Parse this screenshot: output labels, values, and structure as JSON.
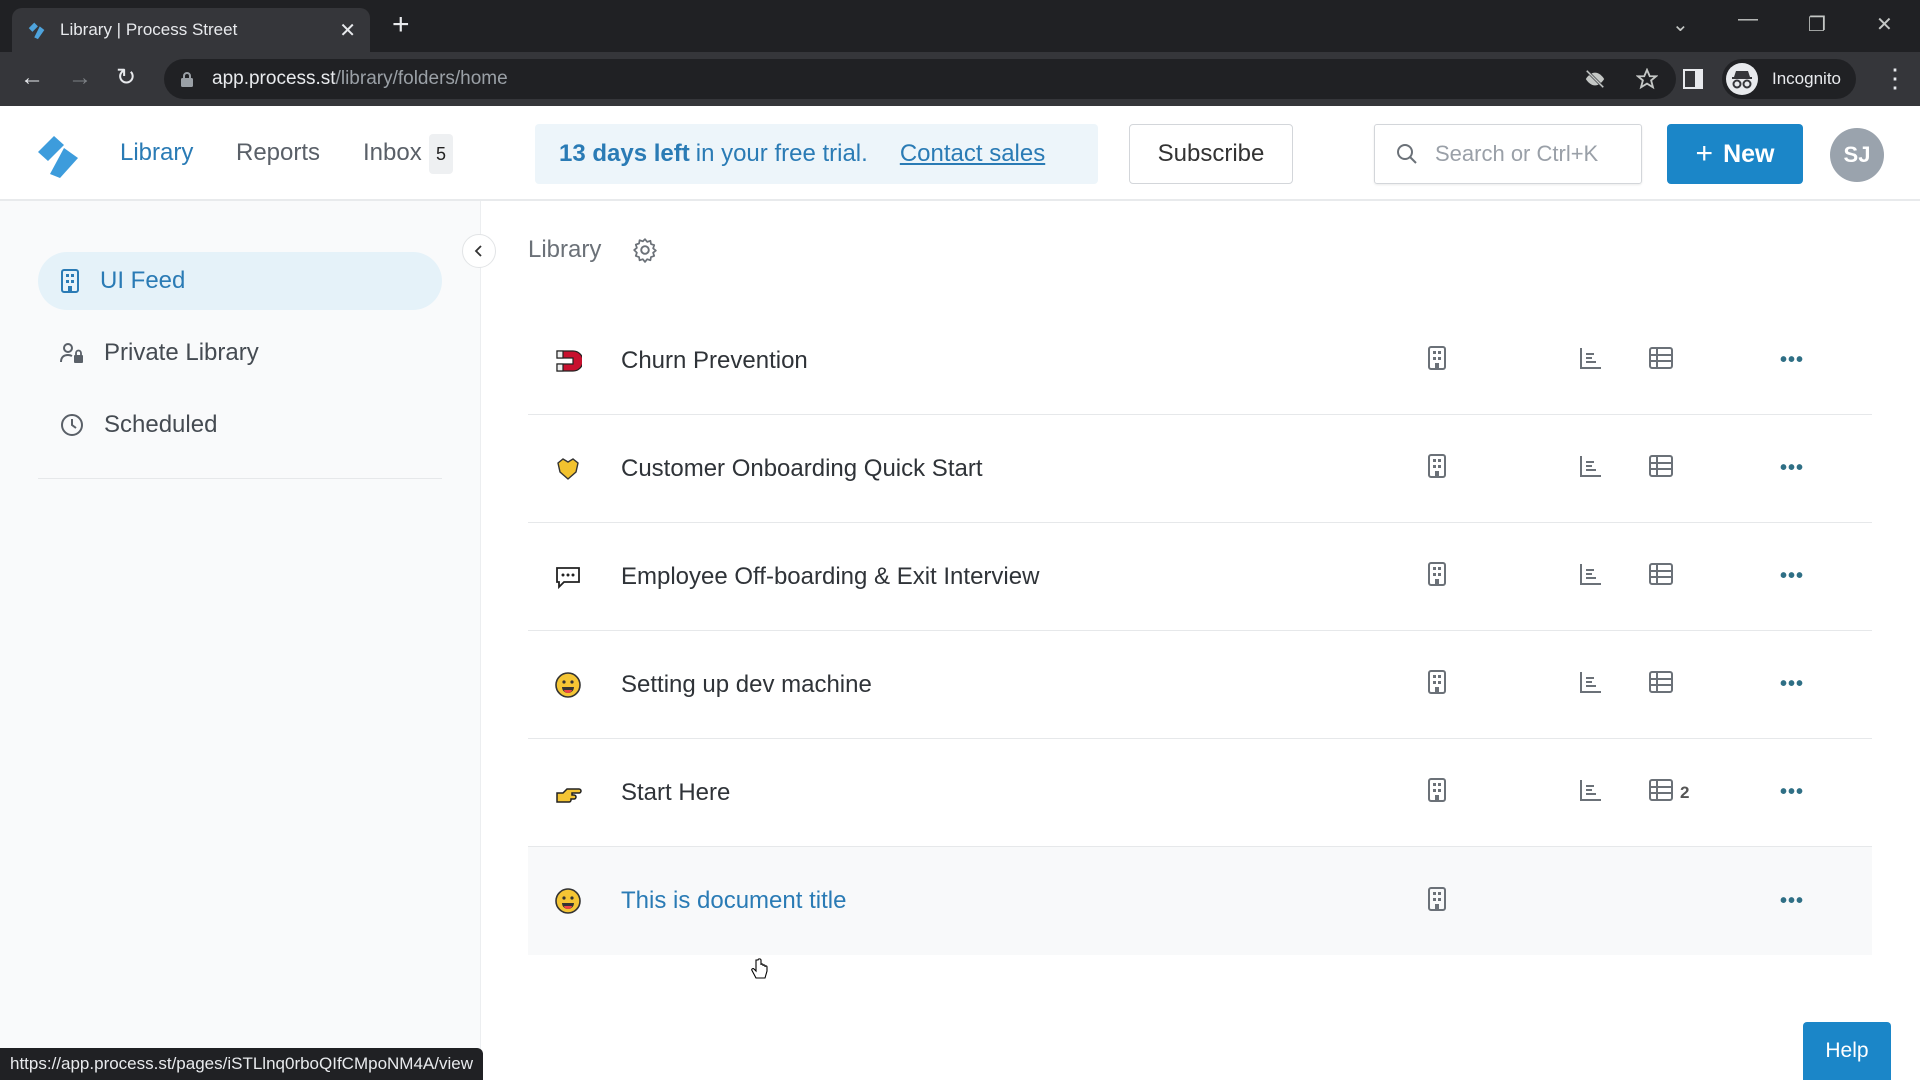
{
  "browser": {
    "tab_title": "Library | Process Street",
    "url_host": "app.process.st",
    "url_path": "/library/folders/home",
    "profile_label": "Incognito",
    "status_url": "https://app.process.st/pages/iSTLlnq0rboQIfCMpoNM4A/view"
  },
  "header": {
    "nav": [
      {
        "label": "Library",
        "active": true
      },
      {
        "label": "Reports"
      },
      {
        "label": "Inbox",
        "badge": "5"
      }
    ],
    "trial": {
      "bold": "13 days left",
      "text": "in your free trial.",
      "link": "Contact sales"
    },
    "subscribe_label": "Subscribe",
    "search_placeholder": "Search or Ctrl+K",
    "new_label": "New",
    "avatar_initials": "SJ"
  },
  "sidebar": {
    "items": [
      {
        "label": "UI Feed",
        "icon": "building-icon",
        "active": true
      },
      {
        "label": "Private Library",
        "icon": "user-lock-icon"
      },
      {
        "label": "Scheduled",
        "icon": "clock-icon"
      }
    ]
  },
  "main": {
    "breadcrumb": "Library",
    "rows": [
      {
        "name": "Churn Prevention",
        "emoji": "magnet-icon",
        "has_reports": true,
        "has_table": true,
        "table_count": ""
      },
      {
        "name": "Customer Onboarding Quick Start",
        "emoji": "shield-heart-icon",
        "has_reports": true,
        "has_table": true,
        "table_count": ""
      },
      {
        "name": "Employee Off-boarding & Exit Interview",
        "emoji": "speech-bubble-icon",
        "has_reports": true,
        "has_table": true,
        "table_count": ""
      },
      {
        "name": "Setting up dev machine",
        "emoji": "smiley-icon",
        "has_reports": true,
        "has_table": true,
        "table_count": ""
      },
      {
        "name": "Start Here",
        "emoji": "pointing-hand-icon",
        "has_reports": true,
        "has_table": true,
        "table_count": "2"
      },
      {
        "name": "This is document title",
        "emoji": "smiley-icon",
        "has_reports": false,
        "has_table": false,
        "table_count": ""
      }
    ],
    "more_label": "•••"
  },
  "help_label": "Help",
  "colors": {
    "accent": "#1b86c8",
    "link": "#2a7bb5",
    "trial_bg": "#edf5fa"
  }
}
